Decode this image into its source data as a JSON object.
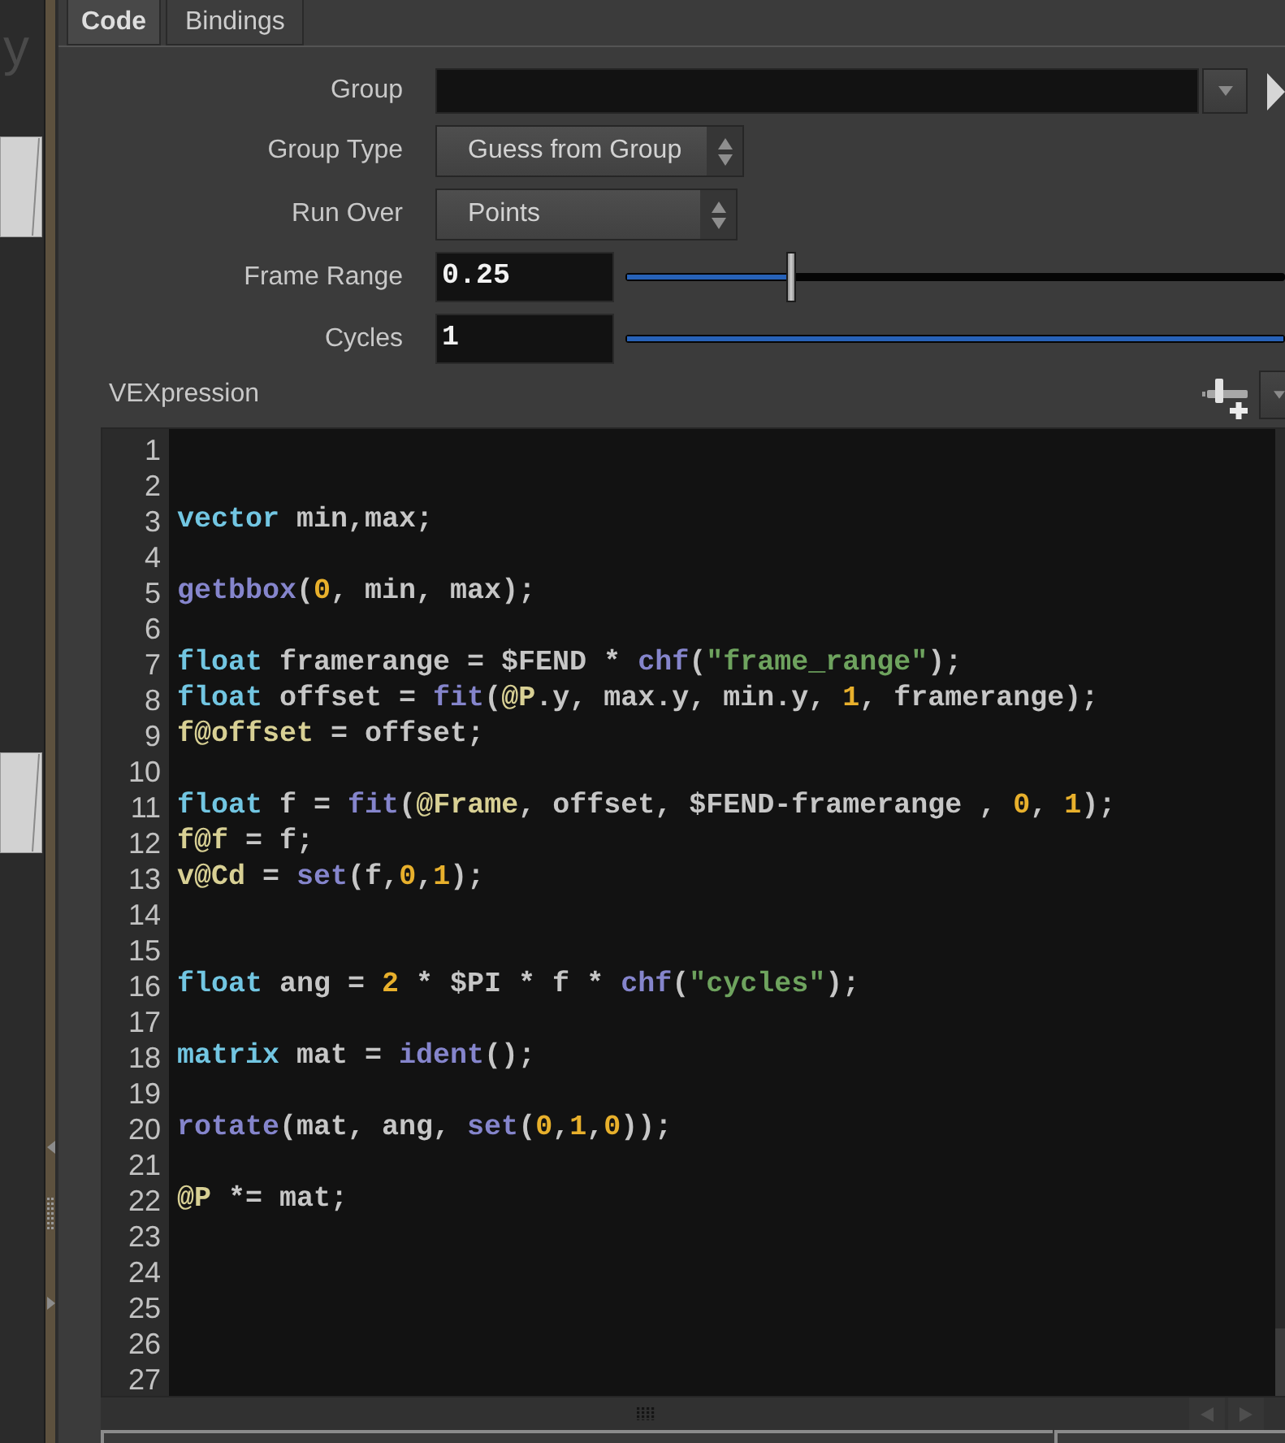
{
  "network_view": {
    "caption": "y"
  },
  "tabs": [
    {
      "label": "Code",
      "selected": true
    },
    {
      "label": "Bindings",
      "selected": false
    }
  ],
  "parameters": [
    {
      "kind": "group_field",
      "label": "Group"
    },
    {
      "kind": "menu",
      "label": "Group Type",
      "value": "Guess from Group"
    },
    {
      "kind": "menu",
      "label": "Run Over",
      "value": "Points"
    },
    {
      "kind": "slider",
      "label": "Frame Range",
      "value": "0.25",
      "level": 0.25
    },
    {
      "kind": "slider",
      "label": "Cycles",
      "value": "1",
      "level": 1
    }
  ],
  "editor": {
    "label": "VEXpression",
    "lines": [
      {
        "number": "1"
      },
      {
        "number": "2"
      },
      {
        "number": "3",
        "tokens": [
          {
            "kind": "keyword",
            "text": "vector"
          },
          {
            "kind": "plain",
            "text": " min,max;"
          }
        ]
      },
      {
        "number": "4"
      },
      {
        "number": "5",
        "tokens": [
          {
            "kind": "function",
            "text": "getbbox"
          },
          {
            "kind": "plain",
            "text": "("
          },
          {
            "kind": "number",
            "text": "0"
          },
          {
            "kind": "plain",
            "text": ", min, max);"
          }
        ]
      },
      {
        "number": "6"
      },
      {
        "number": "7",
        "tokens": [
          {
            "kind": "keyword",
            "text": "float"
          },
          {
            "kind": "plain",
            "text": " framerange = $FEND * "
          },
          {
            "kind": "function",
            "text": "chf"
          },
          {
            "kind": "plain",
            "text": "("
          },
          {
            "kind": "string",
            "text": "\"frame_range\""
          },
          {
            "kind": "plain",
            "text": ");"
          }
        ]
      },
      {
        "number": "8",
        "tokens": [
          {
            "kind": "keyword",
            "text": "float"
          },
          {
            "kind": "plain",
            "text": " offset = "
          },
          {
            "kind": "function",
            "text": "fit"
          },
          {
            "kind": "plain",
            "text": "("
          },
          {
            "kind": "attribute",
            "text": "@P"
          },
          {
            "kind": "plain",
            "text": ".y, max.y, min.y, "
          },
          {
            "kind": "number",
            "text": "1"
          },
          {
            "kind": "plain",
            "text": ", framerange);"
          }
        ]
      },
      {
        "number": "9",
        "tokens": [
          {
            "kind": "attribute",
            "text": "f@offset"
          },
          {
            "kind": "plain",
            "text": " = offset;"
          }
        ]
      },
      {
        "number": "10"
      },
      {
        "number": "11",
        "tokens": [
          {
            "kind": "keyword",
            "text": "float"
          },
          {
            "kind": "plain",
            "text": " f = "
          },
          {
            "kind": "function",
            "text": "fit"
          },
          {
            "kind": "plain",
            "text": "("
          },
          {
            "kind": "attribute",
            "text": "@Frame"
          },
          {
            "kind": "plain",
            "text": ", offset, $FEND-framerange , "
          },
          {
            "kind": "number",
            "text": "0"
          },
          {
            "kind": "plain",
            "text": ", "
          },
          {
            "kind": "number",
            "text": "1"
          },
          {
            "kind": "plain",
            "text": ");"
          }
        ]
      },
      {
        "number": "12",
        "tokens": [
          {
            "kind": "attribute",
            "text": "f@f"
          },
          {
            "kind": "plain",
            "text": " = f;"
          }
        ]
      },
      {
        "number": "13",
        "tokens": [
          {
            "kind": "attribute",
            "text": "v@Cd"
          },
          {
            "kind": "plain",
            "text": " = "
          },
          {
            "kind": "function",
            "text": "set"
          },
          {
            "kind": "plain",
            "text": "(f,"
          },
          {
            "kind": "number",
            "text": "0"
          },
          {
            "kind": "plain",
            "text": ","
          },
          {
            "kind": "number",
            "text": "1"
          },
          {
            "kind": "plain",
            "text": ");"
          }
        ]
      },
      {
        "number": "14"
      },
      {
        "number": "15"
      },
      {
        "number": "16",
        "tokens": [
          {
            "kind": "keyword",
            "text": "float"
          },
          {
            "kind": "plain",
            "text": " ang = "
          },
          {
            "kind": "number",
            "text": "2"
          },
          {
            "kind": "plain",
            "text": " * $PI * f * "
          },
          {
            "kind": "function",
            "text": "chf"
          },
          {
            "kind": "plain",
            "text": "("
          },
          {
            "kind": "string",
            "text": "\"cycles\""
          },
          {
            "kind": "plain",
            "text": ");"
          }
        ]
      },
      {
        "number": "17"
      },
      {
        "number": "18",
        "tokens": [
          {
            "kind": "keyword",
            "text": "matrix"
          },
          {
            "kind": "plain",
            "text": " mat = "
          },
          {
            "kind": "function",
            "text": "ident"
          },
          {
            "kind": "plain",
            "text": "();"
          }
        ]
      },
      {
        "number": "19"
      },
      {
        "number": "20",
        "tokens": [
          {
            "kind": "function",
            "text": "rotate"
          },
          {
            "kind": "plain",
            "text": "(mat, ang, "
          },
          {
            "kind": "function",
            "text": "set"
          },
          {
            "kind": "plain",
            "text": "("
          },
          {
            "kind": "number",
            "text": "0"
          },
          {
            "kind": "plain",
            "text": ","
          },
          {
            "kind": "number",
            "text": "1"
          },
          {
            "kind": "plain",
            "text": ","
          },
          {
            "kind": "number",
            "text": "0"
          },
          {
            "kind": "plain",
            "text": "));"
          }
        ]
      },
      {
        "number": "21"
      },
      {
        "number": "22",
        "tokens": [
          {
            "kind": "attribute",
            "text": "@P"
          },
          {
            "kind": "plain",
            "text": " *= mat;"
          }
        ]
      },
      {
        "number": "23"
      },
      {
        "number": "24"
      },
      {
        "number": "25"
      },
      {
        "number": "26"
      },
      {
        "number": "27"
      }
    ]
  }
}
